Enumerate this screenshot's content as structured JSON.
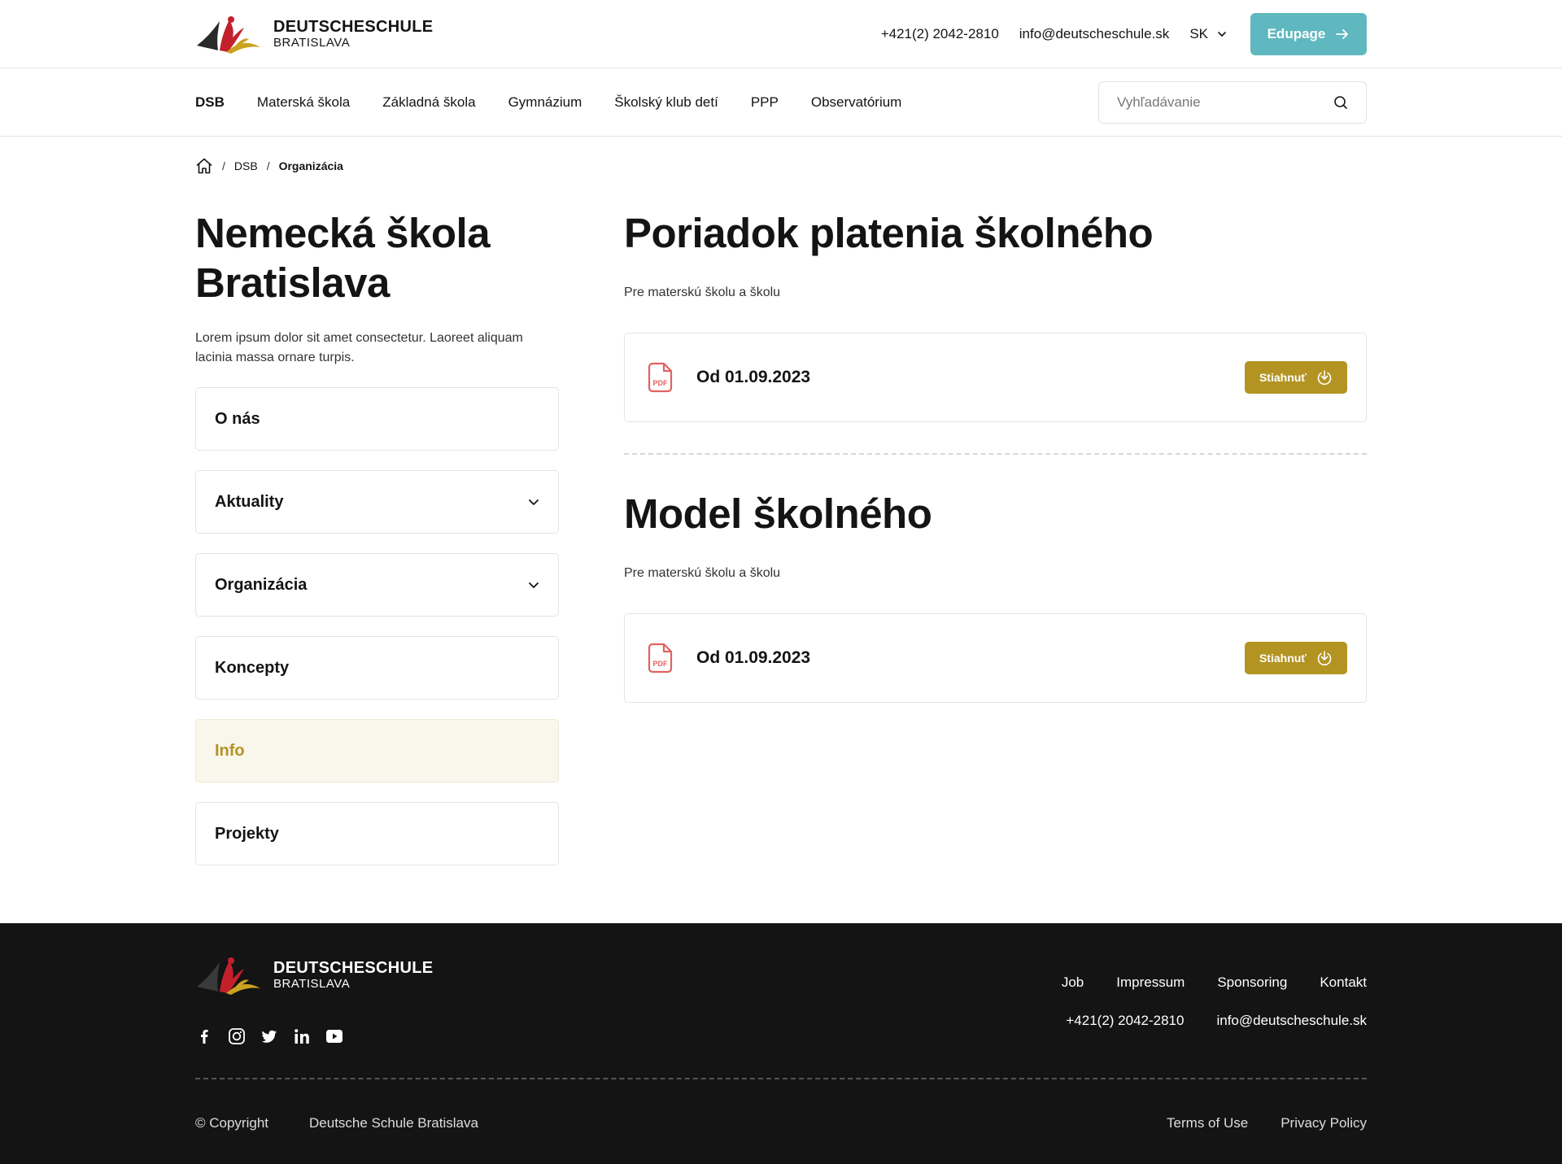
{
  "brand": {
    "name": "DEUTSCHESCHULE",
    "city": "BRATISLAVA"
  },
  "topbar": {
    "phone": "+421(2) 2042-2810",
    "email": "info@deutscheschule.sk",
    "language": "SK",
    "edupage_label": "Edupage"
  },
  "nav": {
    "items": [
      "DSB",
      "Materská škola",
      "Základná škola",
      "Gymnázium",
      "Školský klub detí",
      "PPP",
      "Observatórium"
    ],
    "search_placeholder": "Vyhľadávanie"
  },
  "breadcrumb": {
    "items": [
      "DSB",
      "Organizácia"
    ]
  },
  "sidebar": {
    "title": "Nemecká škola Bratislava",
    "intro": "Lorem ipsum dolor sit amet consectetur. Laoreet aliquam lacinia massa ornare turpis.",
    "items": [
      {
        "label": "O nás",
        "expandable": false
      },
      {
        "label": "Aktuality",
        "expandable": true
      },
      {
        "label": "Organizácia",
        "expandable": true
      },
      {
        "label": "Koncepty",
        "expandable": false
      },
      {
        "label": "Info",
        "expandable": false,
        "active": true
      },
      {
        "label": "Projekty",
        "expandable": false
      }
    ]
  },
  "sections": [
    {
      "title": "Poriadok platenia školného",
      "subtitle": "Pre materskú školu a školu",
      "doc_title": "Od 01.09.2023",
      "button_label": "Stiahnuť",
      "file_badge": "PDF"
    },
    {
      "title": "Model školného",
      "subtitle": "Pre materskú školu a školu",
      "doc_title": "Od 01.09.2023",
      "button_label": "Stiahnuť",
      "file_badge": "PDF"
    }
  ],
  "footer": {
    "links": [
      "Job",
      "Impressum",
      "Sponsoring",
      "Kontakt"
    ],
    "phone": "+421(2) 2042-2810",
    "email": "info@deutscheschule.sk",
    "copyright": "© Copyright",
    "company": "Deutsche Schule Bratislava",
    "terms": "Terms of Use",
    "privacy": "Privacy Policy",
    "social_icons": [
      "facebook-icon",
      "instagram-icon",
      "twitter-icon",
      "linkedin-icon",
      "youtube-icon"
    ]
  },
  "colors": {
    "accent_teal": "#5fb8bf",
    "accent_gold": "#b39422",
    "active_bg": "#f9f6ec",
    "pdf_red": "#e0625f",
    "footer_bg": "#141414"
  }
}
